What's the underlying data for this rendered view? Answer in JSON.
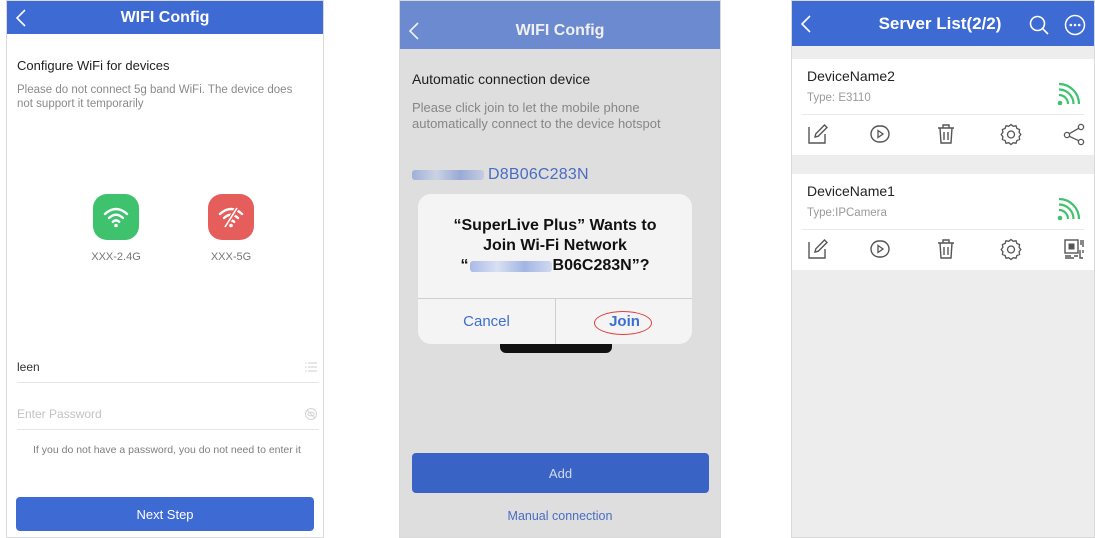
{
  "screen1": {
    "title": "WIFI Config",
    "heading": "Configure WiFi for devices",
    "hint": "Please do not connect 5g band WiFi. The device does not support it temporarily",
    "options": [
      {
        "label": "XXX-2.4G",
        "color": "#3ec26e",
        "icon": "wifi-icon"
      },
      {
        "label": "XXX-5G",
        "color": "#e65e5c",
        "icon": "wifi-off-icon"
      }
    ],
    "ssid_value": "leen",
    "password_placeholder": "Enter Password",
    "note": "If you do not have a password, you do not need to enter it",
    "next_label": "Next Step"
  },
  "screen2": {
    "title": "WIFI Config",
    "heading": "Automatic connection device",
    "hint": "Please click join to let the mobile phone automatically connect to the device hotspot",
    "ssid_visible": "D8B06C283N",
    "alert": {
      "line1": "“SuperLive Plus” Wants to",
      "line2": "Join Wi-Fi Network",
      "line3_open": "“",
      "line3_visible": "B06C283N”?",
      "cancel": "Cancel",
      "join": "Join"
    },
    "add_label": "Add",
    "manual_label": "Manual connection"
  },
  "screen3": {
    "title": "Server List(2/2)",
    "devices": [
      {
        "name": "DeviceName2",
        "type": "Type:  E3110",
        "last_action": "share-icon"
      },
      {
        "name": "DeviceName1",
        "type": "Type:IPCamera",
        "last_action": "qr-code-icon"
      }
    ],
    "accent": "#3e6ad3",
    "signal_color": "#3ec26e"
  }
}
